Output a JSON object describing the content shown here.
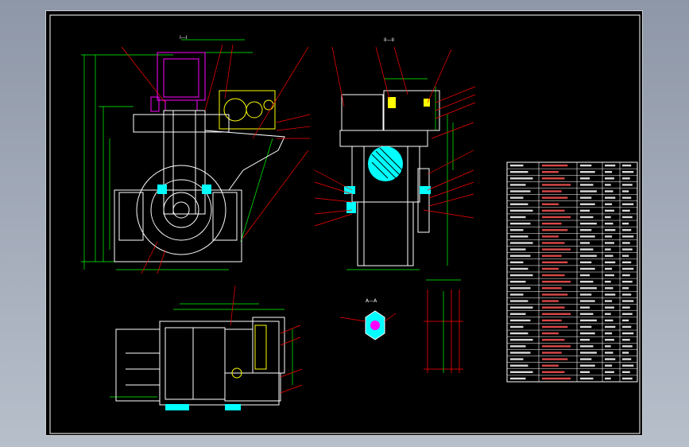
{
  "drawing": {
    "background": "#000000",
    "frame_color": "#ffffff",
    "line_colors": {
      "outline": "#ffffff",
      "dimension": "#00ff00",
      "leader": "#ff0000",
      "cyan": "#00ffff",
      "magenta": "#ff00ff",
      "yellow": "#ffff00"
    },
    "section_labels": {
      "front": "I—I",
      "side": "II—II",
      "detail": "A—A"
    },
    "title_block_rows": 34
  }
}
